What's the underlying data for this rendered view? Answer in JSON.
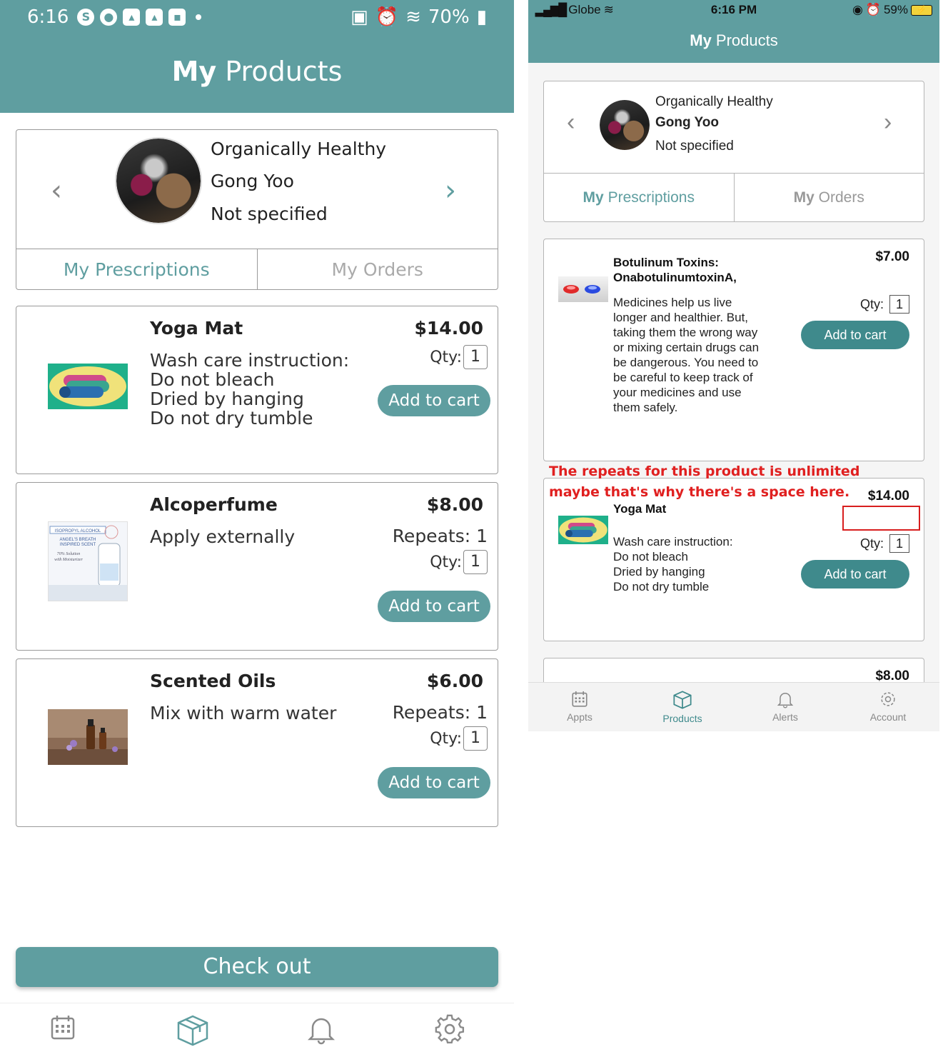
{
  "android": {
    "status": {
      "time": "6:16",
      "battery": "70%"
    },
    "header": {
      "title_bold": "My",
      "title_rest": " Products"
    },
    "profile": {
      "business": "Organically Healthy",
      "name": "Gong Yoo",
      "status": "Not specified",
      "prev": "‹",
      "next": "›"
    },
    "tabs": [
      {
        "label": "My Prescriptions",
        "active": true
      },
      {
        "label": "My Orders",
        "active": false
      }
    ],
    "products": [
      {
        "name": "Yoga Mat",
        "description": "Wash care instruction:\nDo not bleach\nDried by hanging\nDo not dry tumble",
        "price": "$14.00",
        "qty_label": "Qty:",
        "qty": "1",
        "button": "Add to cart",
        "thumb_icon": "yoga-mat-image"
      },
      {
        "name": "Alcoperfume",
        "description": "Apply externally",
        "price": "$8.00",
        "repeats": "Repeats: 1",
        "qty_label": "Qty:",
        "qty": "1",
        "button": "Add to cart",
        "thumb_icon": "alcohol-bottle-image",
        "thumb_text": [
          "ISOPROPYL ALCOHOL",
          "ANGEL'S BREATH",
          "INSPIRED SCENT",
          "70% Solution",
          "with Moisturizer"
        ]
      },
      {
        "name": "Scented Oils",
        "description": "Mix with warm water",
        "price": "$6.00",
        "repeats": "Repeats: 1",
        "qty_label": "Qty:",
        "qty": "1",
        "button": "Add to cart",
        "thumb_icon": "essential-oils-image"
      }
    ],
    "checkout": "Check out",
    "nav": [
      "calendar-icon",
      "box-icon",
      "bell-icon",
      "gear-icon"
    ]
  },
  "ios": {
    "status": {
      "carrier": "Globe",
      "time": "6:16 PM",
      "battery": "59%"
    },
    "header": {
      "title_bold": "My",
      "title_rest": " Products"
    },
    "profile": {
      "business": "Organically Healthy",
      "name": "Gong Yoo",
      "status": "Not specified"
    },
    "tabs": [
      {
        "bold": "My",
        "rest": " Prescriptions",
        "active": true
      },
      {
        "bold": "My",
        "rest": " Orders",
        "active": false
      }
    ],
    "products": [
      {
        "name": "Botulinum Toxins:\nOnabotulinumtoxinA,",
        "description": "Medicines help us live\nlonger and healthier. But,\ntaking them the wrong way\nor mixing certain drugs can\nbe dangerous. You need to\nbe careful to keep track of\nyour medicines and use\nthem safely.",
        "price": "$7.00",
        "qty_label": "Qty:",
        "qty": "1",
        "button": "Add to cart"
      },
      {
        "name": "Yoga Mat",
        "description": "Wash care instruction:\nDo not bleach\nDried by hanging\nDo not dry tumble",
        "price": "$14.00",
        "qty_label": "Qty:",
        "qty": "1",
        "button": "Add to cart"
      },
      {
        "price": "$8.00"
      }
    ],
    "annotation": "The repeats for this product is unlimited\nmaybe that's why there's a space here.",
    "nav": [
      {
        "label": "Appts",
        "icon": "calendar-icon",
        "active": false
      },
      {
        "label": "Products",
        "icon": "box-icon",
        "active": true
      },
      {
        "label": "Alerts",
        "icon": "bell-icon",
        "active": false
      },
      {
        "label": "Account",
        "icon": "gear-icon",
        "active": false
      }
    ],
    "colors": {
      "accent": "#5f9ea0",
      "button": "#3f8a8c",
      "annotation": "#e02020"
    }
  }
}
